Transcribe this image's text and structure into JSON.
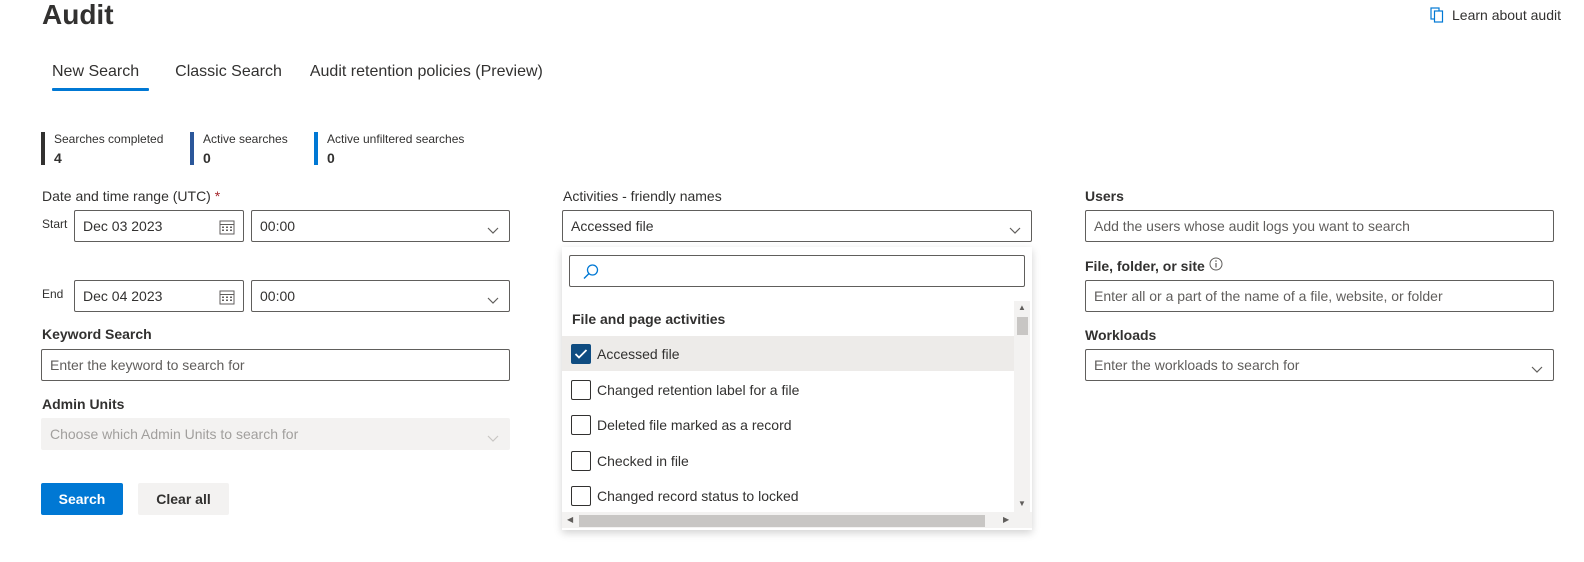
{
  "header": {
    "title": "Audit",
    "learn_link": "Learn about audit"
  },
  "tabs": [
    {
      "label": "New Search",
      "active": true
    },
    {
      "label": "Classic Search",
      "active": false
    },
    {
      "label": "Audit retention policies (Preview)",
      "active": false
    }
  ],
  "stats": [
    {
      "label": "Searches completed",
      "value": "4",
      "color": "#323130"
    },
    {
      "label": "Active searches",
      "value": "0",
      "color": "#2b579a"
    },
    {
      "label": "Active unfiltered searches",
      "value": "0",
      "color": "#0078d4"
    }
  ],
  "date_range": {
    "label": "Date and time range (UTC)",
    "required_mark": "*",
    "start_label": "Start",
    "start_date": "Dec 03 2023",
    "start_time": "00:00",
    "end_label": "End",
    "end_date": "Dec 04 2023",
    "end_time": "00:00"
  },
  "keyword": {
    "label": "Keyword Search",
    "placeholder": "Enter the keyword to search for"
  },
  "admin_units": {
    "label": "Admin Units",
    "placeholder": "Choose which Admin Units to search for"
  },
  "buttons": {
    "search": "Search",
    "clear": "Clear all"
  },
  "activities": {
    "label": "Activities - friendly names",
    "selected": "Accessed file",
    "search_value": "",
    "group": "File and page activities",
    "options": [
      {
        "label": "Accessed file",
        "checked": true
      },
      {
        "label": "Changed retention label for a file",
        "checked": false
      },
      {
        "label": "Deleted file marked as a record",
        "checked": false
      },
      {
        "label": "Checked in file",
        "checked": false
      },
      {
        "label": "Changed record status to locked",
        "checked": false
      }
    ]
  },
  "users": {
    "label": "Users",
    "placeholder": "Add the users whose audit logs you want to search"
  },
  "file_site": {
    "label": "File, folder, or site",
    "placeholder": "Enter all or a part of the name of a file, website, or folder"
  },
  "workloads": {
    "label": "Workloads",
    "placeholder": "Enter the workloads to search for"
  },
  "colors": {
    "accent": "#0078d4",
    "checkbox_fill": "#0f4c81",
    "required": "#a4262c"
  }
}
